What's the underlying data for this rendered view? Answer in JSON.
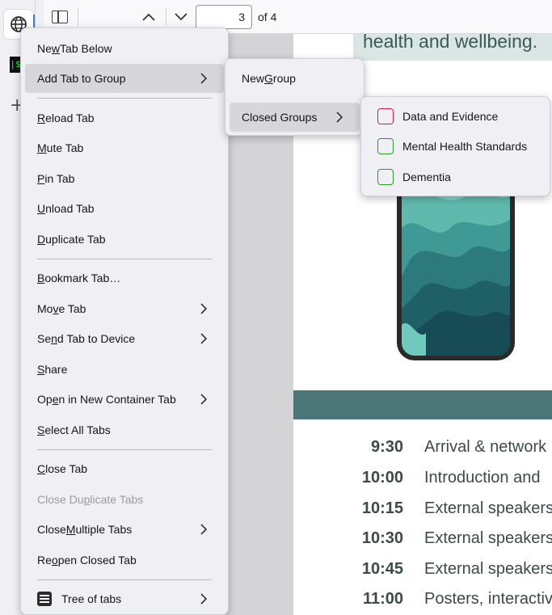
{
  "toolbar": {
    "page_number": "3",
    "page_of": "of 4"
  },
  "tabstrip": {
    "terminal_glyph": "|$"
  },
  "document": {
    "headline": "health and wellbeing.",
    "schedule": [
      {
        "time": "9:30",
        "text": "Arrival & network"
      },
      {
        "time": "10:00",
        "text": "Introduction and"
      },
      {
        "time": "10:15",
        "text": "External speakers"
      },
      {
        "time": "10:30",
        "text": "External speakers"
      },
      {
        "time": "10:45",
        "text": "External speakers"
      },
      {
        "time": "11:00",
        "text": "Posters, interactiv"
      }
    ]
  },
  "context_menu": {
    "items": [
      {
        "pre": "Ne",
        "key": "w",
        "post": " Tab Below"
      },
      {
        "pre": "Add Tab to Group",
        "key": "",
        "post": ""
      },
      {
        "pre": "",
        "key": "R",
        "post": "eload Tab"
      },
      {
        "pre": "",
        "key": "M",
        "post": "ute Tab"
      },
      {
        "pre": "",
        "key": "P",
        "post": "in Tab"
      },
      {
        "pre": "",
        "key": "U",
        "post": "nload Tab"
      },
      {
        "pre": "",
        "key": "D",
        "post": "uplicate Tab"
      },
      {
        "pre": "",
        "key": "B",
        "post": "ookmark Tab…"
      },
      {
        "pre": "Mo",
        "key": "v",
        "post": "e Tab"
      },
      {
        "pre": "Se",
        "key": "n",
        "post": "d Tab to Device"
      },
      {
        "pre": "",
        "key": "S",
        "post": "hare"
      },
      {
        "pre": "Op",
        "key": "e",
        "post": "n in New Container Tab"
      },
      {
        "pre": "",
        "key": "S",
        "post": "elect All Tabs"
      },
      {
        "pre": "",
        "key": "C",
        "post": "lose Tab"
      },
      {
        "pre": "Close Du",
        "key": "p",
        "post": "licate Tabs"
      },
      {
        "pre": "Close ",
        "key": "M",
        "post": "ultiple Tabs"
      },
      {
        "pre": "Re",
        "key": "o",
        "post": "pen Closed Tab"
      },
      {
        "pre": "Tree of tabs",
        "key": "",
        "post": ""
      }
    ]
  },
  "group_submenu": {
    "new_group": {
      "pre": "New ",
      "key": "G",
      "post": "roup"
    },
    "closed_groups": "Closed Groups"
  },
  "closed_groups": [
    {
      "name": "Data and Evidence",
      "color": "#c8234f"
    },
    {
      "name": "Mental Health Standards",
      "color": "#2a9a2a"
    },
    {
      "name": "Dementia",
      "color": "#2a9a2a"
    }
  ]
}
